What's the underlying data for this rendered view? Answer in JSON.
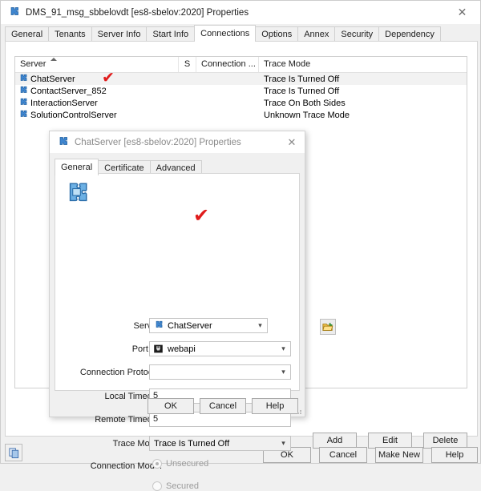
{
  "outer_window": {
    "title": "DMS_91_msg_sbbelovdt [es8-sbelov:2020] Properties",
    "title_icon": "puzzle-piece-icon",
    "close_label": "✕",
    "tabs": [
      {
        "label": "General",
        "active": false
      },
      {
        "label": "Tenants",
        "active": false
      },
      {
        "label": "Server Info",
        "active": false
      },
      {
        "label": "Start Info",
        "active": false
      },
      {
        "label": "Connections",
        "active": true
      },
      {
        "label": "Options",
        "active": false
      },
      {
        "label": "Annex",
        "active": false
      },
      {
        "label": "Security",
        "active": false
      },
      {
        "label": "Dependency",
        "active": false
      }
    ],
    "list": {
      "columns": [
        {
          "label": "Server",
          "sorted": "asc"
        },
        {
          "label": "S"
        },
        {
          "label": "Connection ..."
        },
        {
          "label": "Trace Mode"
        }
      ],
      "rows": [
        {
          "server": "ChatServer",
          "s": "",
          "connection": "",
          "trace_mode": "Trace Is Turned Off",
          "selected": true
        },
        {
          "server": "ContactServer_852",
          "s": "",
          "connection": "",
          "trace_mode": "Trace Is Turned Off",
          "selected": false
        },
        {
          "server": "InteractionServer",
          "s": "",
          "connection": "",
          "trace_mode": "Trace On Both Sides",
          "selected": false
        },
        {
          "server": "SolutionControlServer",
          "s": "",
          "connection": "",
          "trace_mode": "Unknown Trace Mode",
          "selected": false
        }
      ]
    },
    "list_buttons": {
      "add": "Add",
      "edit": "Edit",
      "delete": "Delete"
    },
    "footer": {
      "copy_icon": "copy-pages-icon",
      "ok": "OK",
      "cancel": "Cancel",
      "make_new": "Make New",
      "help": "Help"
    }
  },
  "inner_dialog": {
    "title": "ChatServer [es8-sbelov:2020] Properties",
    "title_icon": "puzzle-piece-icon",
    "close_label": "✕",
    "tabs": [
      {
        "label": "General",
        "active": true
      },
      {
        "label": "Certificate",
        "active": false
      },
      {
        "label": "Advanced",
        "active": false
      }
    ],
    "form": {
      "big_icon": "puzzle-piece-large-icon",
      "server": {
        "label": "Server:",
        "value": "ChatServer",
        "icon": "puzzle-piece-icon",
        "browse_icon": "open-folder-icon"
      },
      "port_id": {
        "label": "Port ID:",
        "value": "webapi",
        "icon": "network-port-icon"
      },
      "connection_protocol": {
        "label": "Connection Protocol:",
        "value": ""
      },
      "local_timeout": {
        "label": "Local Timeout:",
        "value": "5"
      },
      "remote_timeout": {
        "label": "Remote Timeout:",
        "value": "5"
      },
      "trace_mode": {
        "label": "Trace Mode:",
        "value": "Trace Is Turned Off"
      },
      "connection_mode": {
        "label": "Connection Mode:",
        "options": [
          {
            "label": "Unsecured",
            "checked": true
          },
          {
            "label": "Secured",
            "checked": false
          }
        ]
      }
    },
    "buttons": {
      "ok": "OK",
      "cancel": "Cancel",
      "help": "Help"
    }
  },
  "annotations": [
    {
      "name": "red-check-chatserver-row",
      "glyph": "✔"
    },
    {
      "name": "red-check-port-id",
      "glyph": "✔"
    }
  ],
  "colors": {
    "accent_red": "#e01b1b",
    "window_bg": "#f0f0f0",
    "panel_bg": "#ffffff",
    "selection": "#f2f2f2"
  }
}
